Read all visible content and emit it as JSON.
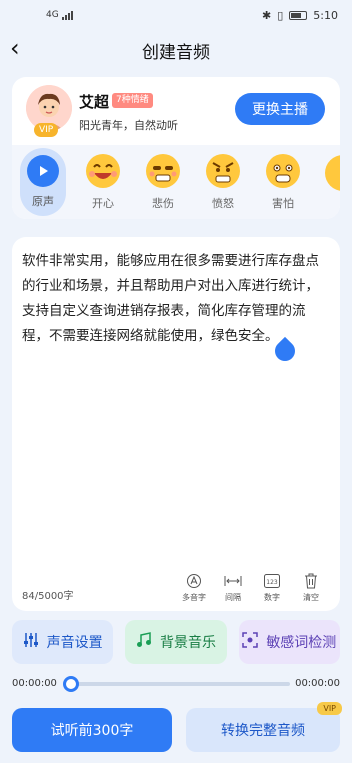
{
  "status_bar": {
    "network": "4G",
    "time": "5:10",
    "battery": "100"
  },
  "nav": {
    "title": "创建音频"
  },
  "speaker": {
    "name": "艾超",
    "tag": "7种情绪",
    "desc": "阳光青年，自然动听",
    "vip": "VIP",
    "change_label": "更换主播"
  },
  "emotions": [
    {
      "label": "原声",
      "icon": "play-icon",
      "active": true
    },
    {
      "label": "开心",
      "icon": "happy-face-icon"
    },
    {
      "label": "悲伤",
      "icon": "sad-face-icon"
    },
    {
      "label": "愤怒",
      "icon": "angry-face-icon"
    },
    {
      "label": "害怕",
      "icon": "scared-face-icon"
    }
  ],
  "text": {
    "content": "软件非常实用，能够应用在很多需要进行库存盘点的行业和场景，并且帮助用户对出入库进行统计，支持自定义查询进销存报表，简化库存管理的流程，不需要连接网络就能使用，绿色安全。",
    "counter": "84/5000字"
  },
  "tools": [
    {
      "label": "多音字",
      "icon": "polyphone-icon"
    },
    {
      "label": "间隔",
      "icon": "pause-icon"
    },
    {
      "label": "数字",
      "icon": "number-icon"
    },
    {
      "label": "清空",
      "icon": "trash-icon"
    }
  ],
  "actions": [
    {
      "label": "声音设置",
      "icon": "equalizer-icon"
    },
    {
      "label": "背景音乐",
      "icon": "music-icon"
    },
    {
      "label": "敏感词检测",
      "icon": "scan-icon"
    }
  ],
  "player": {
    "current": "00:00:00",
    "total": "00:00:00",
    "progress": 0
  },
  "bottom": {
    "trial_label": "试听前300字",
    "full_label": "转换完整音频",
    "vip": "VIP"
  },
  "colors": {
    "accent": "#2f7bf5",
    "page_bg": "#eef3fb"
  }
}
